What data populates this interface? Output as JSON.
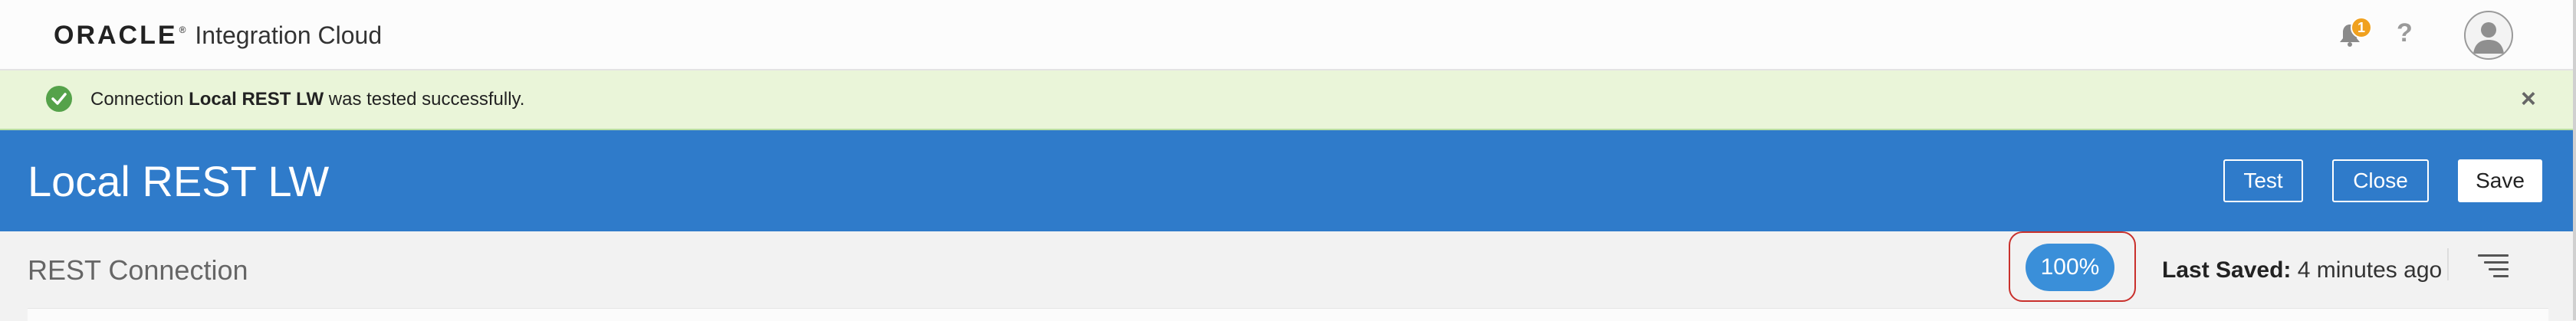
{
  "app": {
    "brand_name": "ORACLE",
    "brand_mark": "®",
    "product_name": "Integration Cloud"
  },
  "header_icons": {
    "notifications_icon": "bell-icon",
    "notification_count": "1",
    "help_label": "?",
    "avatar_icon": "user-avatar-icon"
  },
  "banner": {
    "prefix": "Connection ",
    "connection_name": "Local REST LW",
    "suffix": " was tested successfully.",
    "status_icon": "check-circle-icon",
    "close_label": "×",
    "color": "#eaf5d9"
  },
  "page": {
    "title": "Local REST LW",
    "accent_color": "#2f7bca",
    "buttons": {
      "test": "Test",
      "close": "Close",
      "save": "Save"
    }
  },
  "subheader": {
    "subtitle": "REST Connection",
    "progress": "100%",
    "last_saved_label": "Last Saved:",
    "last_saved_value": " 4 minutes ago",
    "menu_icon": "list-menu-icon"
  }
}
